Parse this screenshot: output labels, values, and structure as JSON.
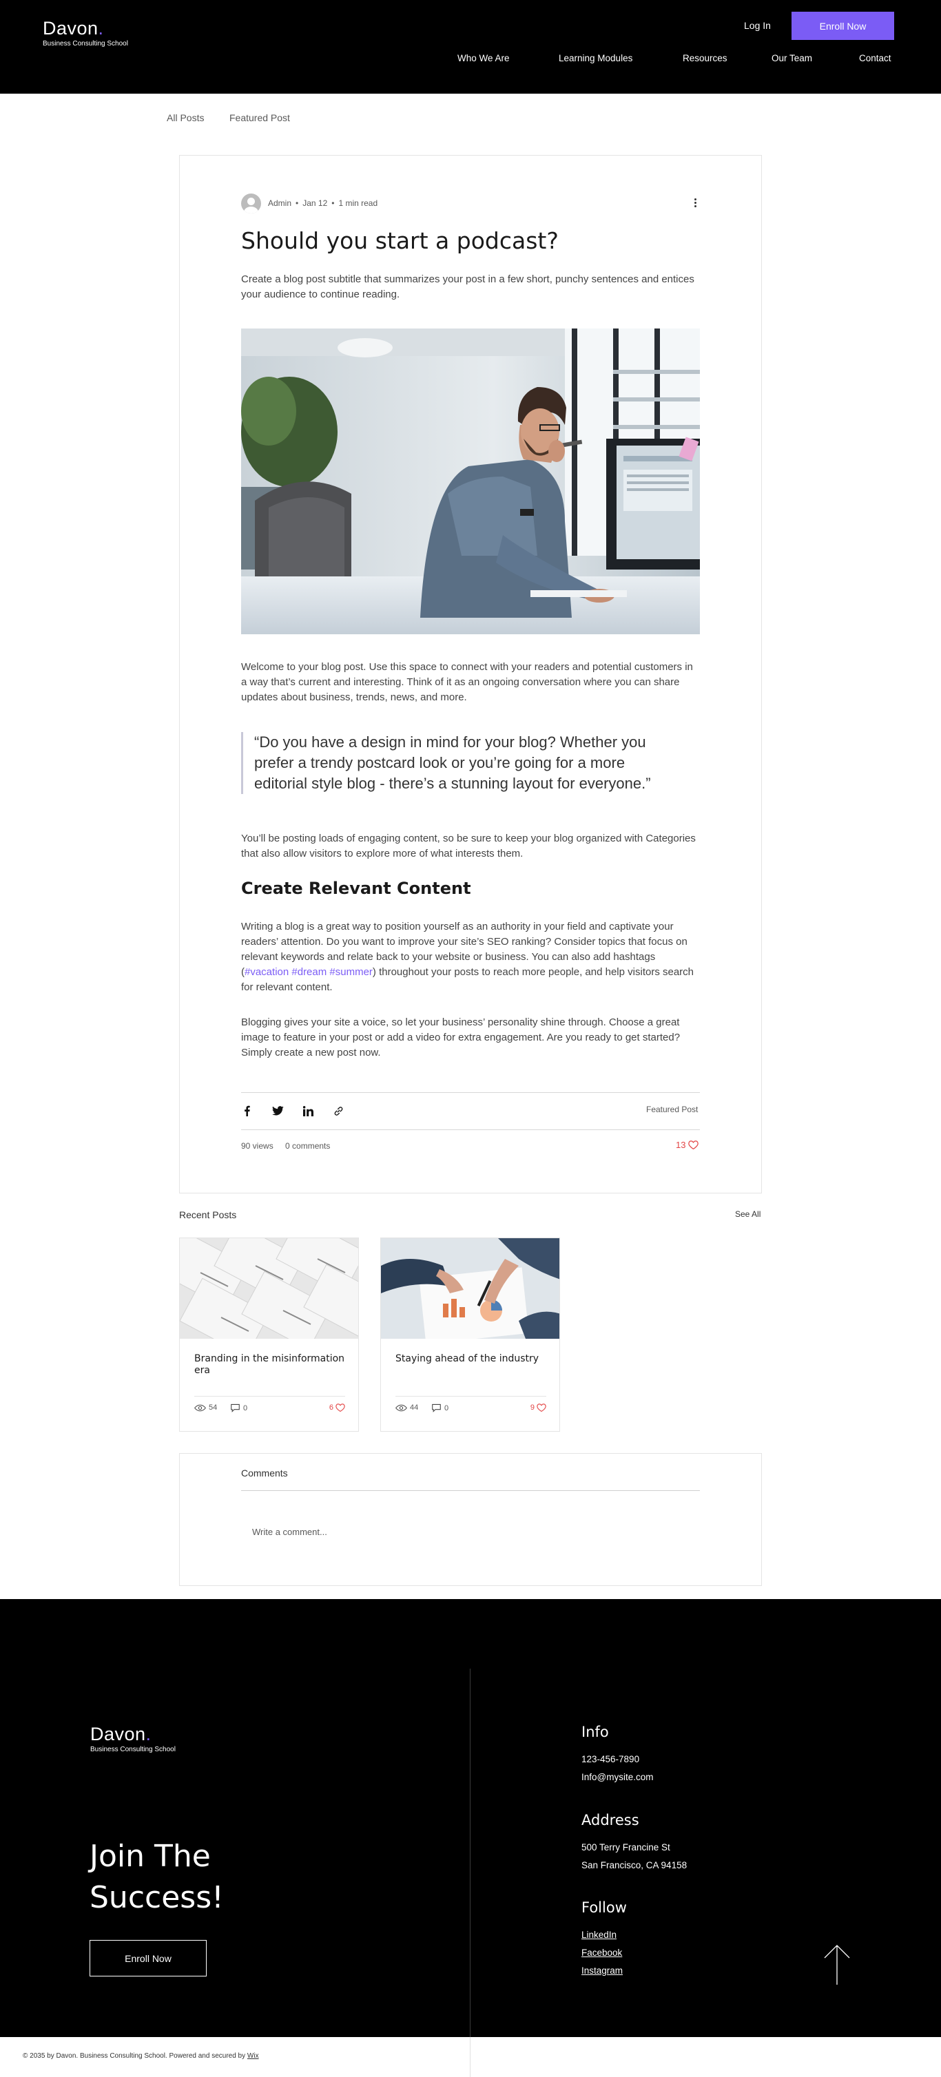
{
  "header": {
    "logo_name": "Davon",
    "logo_dot": ".",
    "logo_sub": "Business Consulting School",
    "login_label": "Log In",
    "enroll_label": "Enroll Now",
    "nav": [
      "Who We Are",
      "Learning Modules",
      "Resources",
      "Our Team",
      "Contact"
    ]
  },
  "tabs": [
    "All Posts",
    "Featured Post"
  ],
  "post": {
    "author": "Admin",
    "date": "Jan 12",
    "read_time": "1 min read",
    "title": "Should you start a podcast?",
    "subtitle": "Create a blog post subtitle that summarizes your post in a few short, punchy sentences and entices your audience to continue reading.",
    "para1": "Welcome to your blog post. Use this space to connect with your readers and potential customers in a way that’s current and interesting. Think of it as an ongoing conversation where you can share updates about business, trends, news, and more.",
    "quote": "“Do you have a design in mind for your blog? Whether you prefer a trendy postcard look or you’re going for a more editorial style blog - there’s a stunning layout for everyone.”",
    "para2": "You’ll be posting loads of engaging content, so be sure to keep your blog organized with Categories that also allow visitors to explore more of what interests them.",
    "heading2": "Create Relevant Content",
    "para3_before": "Writing a blog is a great way to position yourself as an authority in your field and captivate your readers’ attention. Do you want to improve your site’s SEO ranking? Consider topics that focus on relevant keywords and relate back to your website or business. You can also add hashtags (",
    "para3_hashtags": "#vacation #dream #summer",
    "para3_after": ") throughout your posts to reach more people, and help visitors search for relevant content.",
    "para4": "Blogging gives your site a voice, so let your business’ personality shine through. Choose a great image to feature in your post or add a video for extra engagement. Are you ready to get started? Simply create a new post now.",
    "category_link": "Featured Post",
    "views": "90 views",
    "comments": "0 comments",
    "likes": "13"
  },
  "recent": {
    "title": "Recent Posts",
    "see_all": "See All",
    "posts": [
      {
        "title": "Branding in the misinformation era",
        "views": "54",
        "comments": "0",
        "likes": "6"
      },
      {
        "title": "Staying ahead of the industry",
        "views": "44",
        "comments": "0",
        "likes": "9"
      }
    ]
  },
  "comments_section": {
    "title": "Comments",
    "placeholder": "Write a comment..."
  },
  "footer": {
    "logo_name": "Davon",
    "logo_dot": ".",
    "logo_sub": "Business Consulting School",
    "join_line1": "Join The",
    "join_line2": "Success!",
    "enroll_label": "Enroll Now",
    "info_title": "Info",
    "phone": "123-456-7890",
    "email": "Info@mysite.com",
    "address_title": "Address",
    "address1": "500 Terry Francine St",
    "address2": "San Francisco, CA 94158",
    "follow_title": "Follow",
    "links": [
      "LinkedIn",
      "Facebook",
      "Instagram"
    ],
    "copyright": "© 2035 by Davon. Business Consulting School. Powered and secured by ",
    "wix": "Wix"
  },
  "colors": {
    "accent": "#7b5cf5",
    "like": "#e34646",
    "header_bg": "#000000"
  }
}
